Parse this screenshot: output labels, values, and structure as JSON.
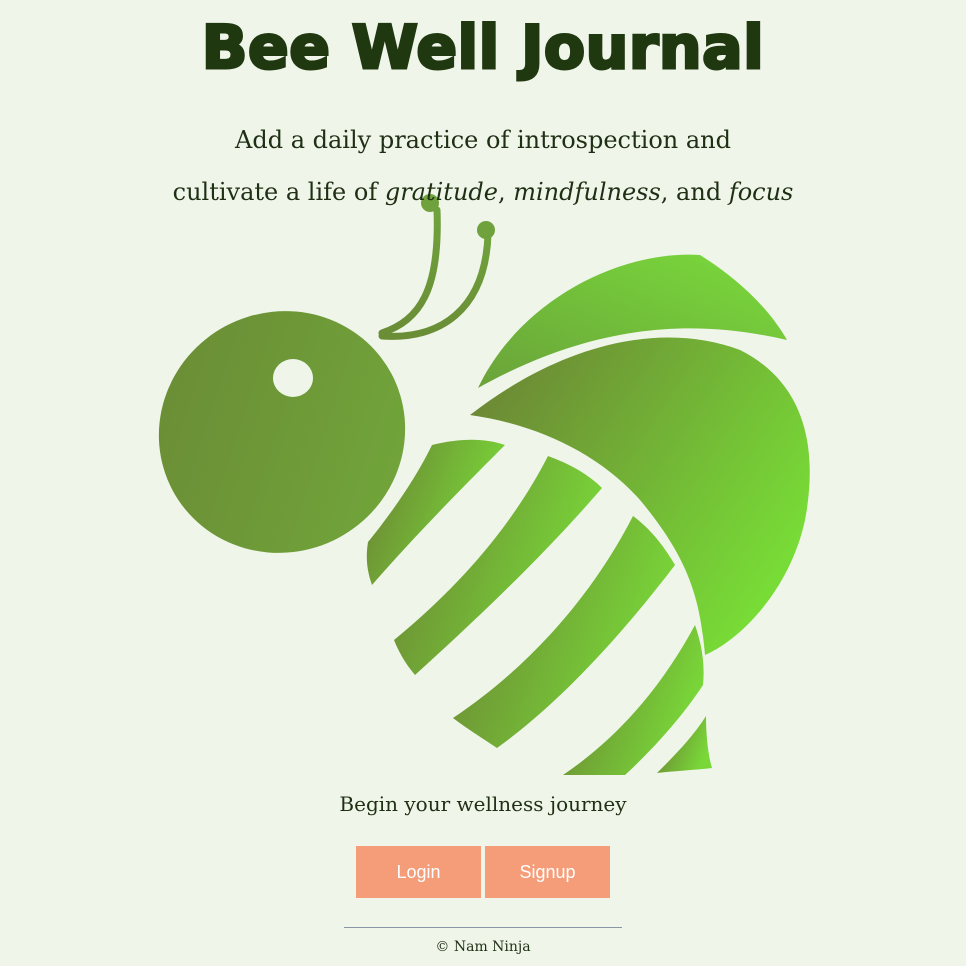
{
  "header": {
    "title": "Bee Well Journal"
  },
  "tagline": {
    "line1": "Add a daily practice of introspection and",
    "line2_prefix": "cultivate a life of ",
    "word_gratitude": "gratitude",
    "sep1": ", ",
    "word_mindfulness": "mindfulness",
    "sep2": ", and ",
    "word_focus": "focus"
  },
  "cta": {
    "prompt": "Begin your wellness journey",
    "login_label": "Login",
    "signup_label": "Signup"
  },
  "footer": {
    "copyright": "© Nam Ninja"
  },
  "colors": {
    "background": "#eff5e9",
    "title": "#203810",
    "button": "#f59c78",
    "logo_dark": "#6a8235",
    "logo_light": "#76d636"
  },
  "logo": {
    "icon": "bee-icon"
  }
}
